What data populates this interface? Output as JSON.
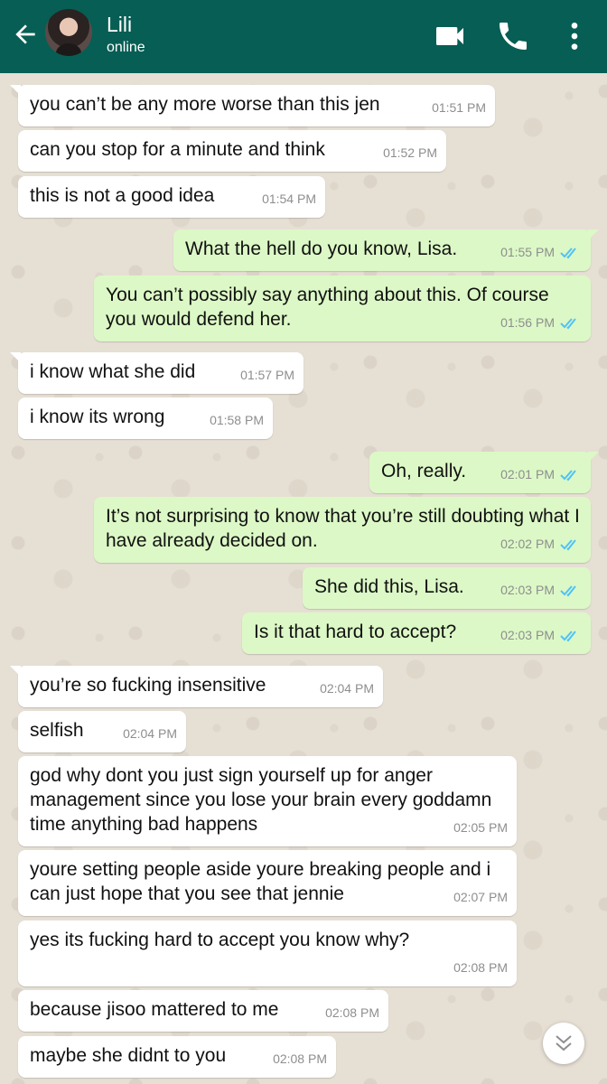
{
  "header": {
    "contact_name": "Lili",
    "status": "online",
    "background_color": "#075e54"
  },
  "icons": {
    "back": "arrow-left-icon",
    "video": "video-camera-icon",
    "call": "phone-icon",
    "menu": "more-vert-icon",
    "scroll": "double-chevron-down-icon"
  },
  "messages": [
    {
      "dir": "in",
      "text": "you can’t be any more worse than this jen",
      "time": "01:51 PM"
    },
    {
      "dir": "in",
      "text": "can you stop for a minute and think",
      "time": "01:52 PM"
    },
    {
      "dir": "in",
      "text": "this is not a good idea",
      "time": "01:54 PM"
    },
    {
      "dir": "out",
      "text": "What the hell do you know, Lisa.",
      "time": "01:55 PM",
      "read": true
    },
    {
      "dir": "out",
      "text": "You can’t possibly say anything about this. Of course you would defend her.",
      "time": "01:56 PM",
      "read": true
    },
    {
      "dir": "in",
      "text": "i know what she did",
      "time": "01:57 PM"
    },
    {
      "dir": "in",
      "text": "i know its wrong",
      "time": "01:58 PM"
    },
    {
      "dir": "out",
      "text": "Oh, really.",
      "time": "02:01 PM",
      "read": true
    },
    {
      "dir": "out",
      "text": "It’s not surprising to know that you’re still doubting what I have already decided on.",
      "time": "02:02 PM",
      "read": true
    },
    {
      "dir": "out",
      "text": "She did this, Lisa.",
      "time": "02:03 PM",
      "read": true
    },
    {
      "dir": "out",
      "text": "Is it that hard to accept?",
      "time": "02:03 PM",
      "read": true
    },
    {
      "dir": "in",
      "text": "you’re so fucking insensitive",
      "time": "02:04 PM"
    },
    {
      "dir": "in",
      "text": "selfish",
      "time": "02:04 PM"
    },
    {
      "dir": "in",
      "text": "god why dont you just sign yourself up for anger management since you lose your brain every goddamn time anything bad happens",
      "time": "02:05 PM"
    },
    {
      "dir": "in",
      "text": "youre setting people aside youre breaking people and i can just hope that you see that jennie",
      "time": "02:07 PM"
    },
    {
      "dir": "in",
      "text": "yes its fucking hard to accept you know why?",
      "time": "02:08 PM"
    },
    {
      "dir": "in",
      "text": "because jisoo mattered to me",
      "time": "02:08 PM"
    },
    {
      "dir": "in",
      "text": "maybe she didnt to you",
      "time": "02:08 PM"
    }
  ]
}
